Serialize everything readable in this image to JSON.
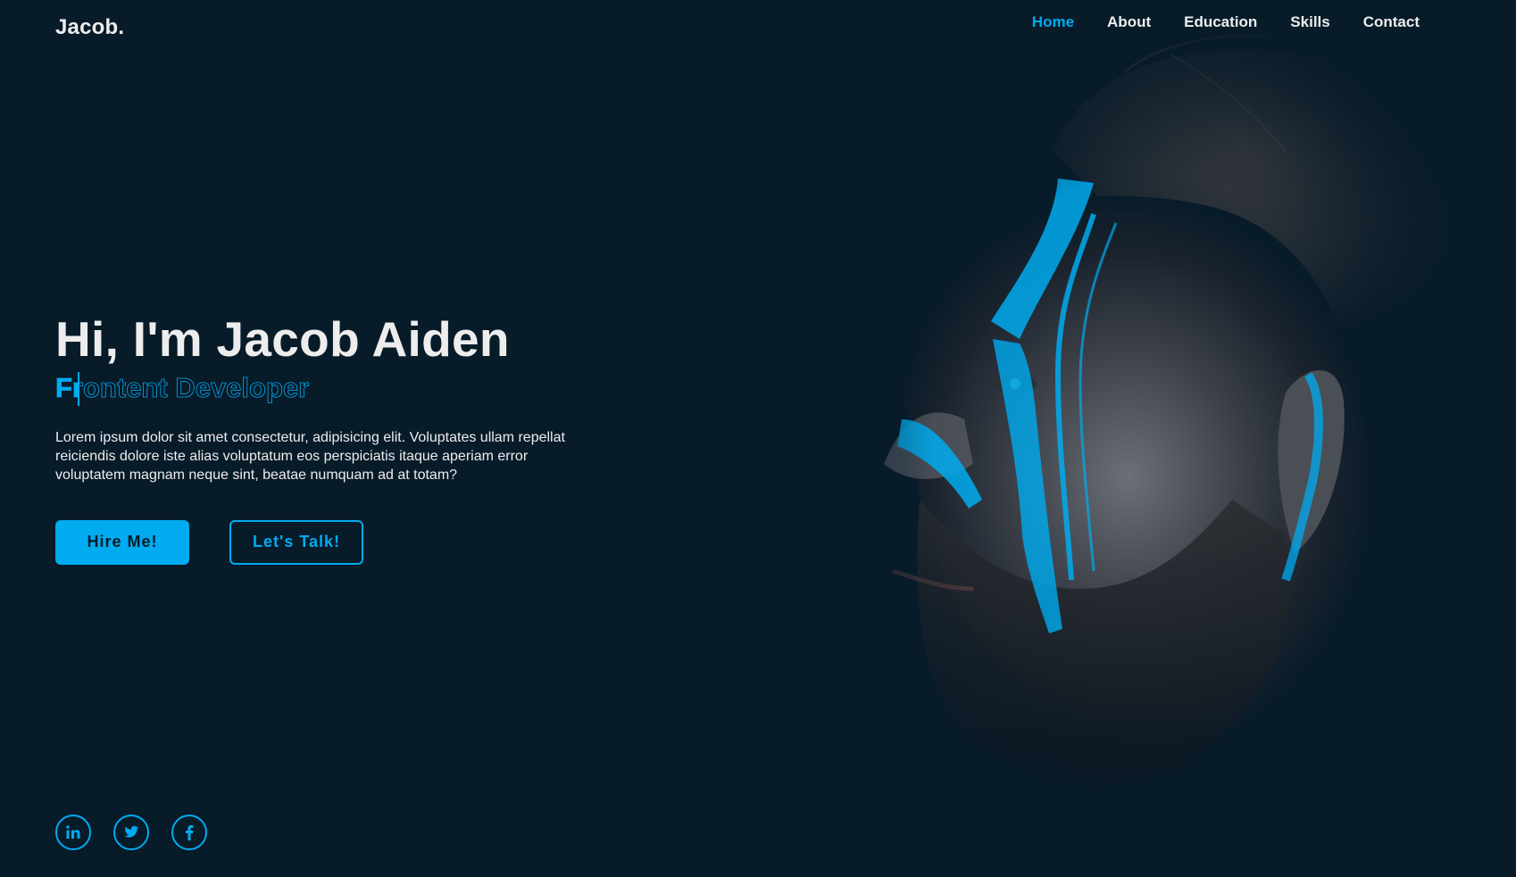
{
  "header": {
    "logo": "Jacob.",
    "nav": [
      {
        "label": "Home",
        "active": true
      },
      {
        "label": "About",
        "active": false
      },
      {
        "label": "Education",
        "active": false
      },
      {
        "label": "Skills",
        "active": false
      },
      {
        "label": "Contact",
        "active": false
      }
    ]
  },
  "hero": {
    "title": "Hi, I'm Jacob Aiden",
    "role": "Frontent Developer",
    "role_typed": "Fr",
    "description": "Lorem ipsum dolor sit amet consectetur, adipisicing elit. Voluptates ullam repellat reiciendis dolore iste alias voluptatum eos perspiciatis itaque aperiam error voluptatem magnam neque sint, beatae numquam ad at totam?",
    "buttons": {
      "hire": "Hire Me!",
      "talk": "Let's Talk!"
    }
  },
  "socials": [
    {
      "icon": "linkedin-icon"
    },
    {
      "icon": "twitter-icon"
    },
    {
      "icon": "facebook-icon"
    }
  ],
  "colors": {
    "background": "#081b29",
    "accent": "#00abf0",
    "text": "#ededed"
  }
}
